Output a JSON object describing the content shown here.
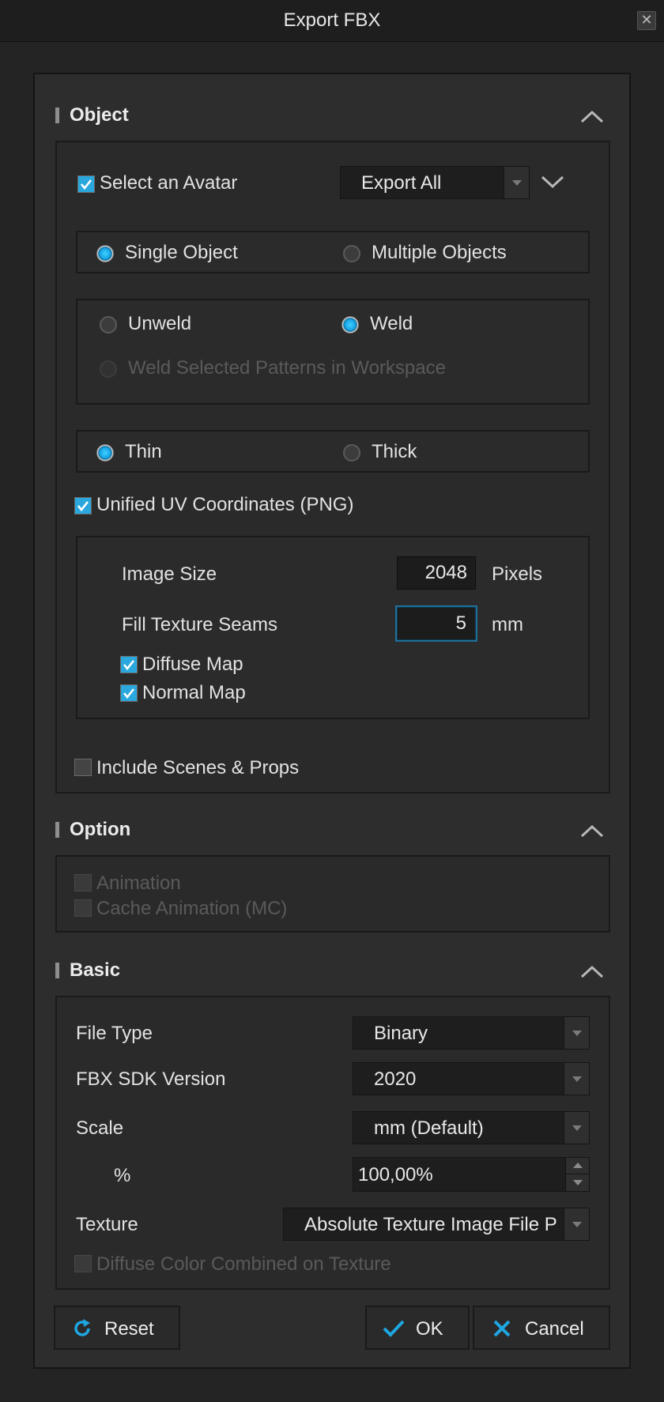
{
  "window": {
    "title": "Export FBX",
    "close_label": "✕"
  },
  "sections": {
    "object": {
      "title": "Object"
    },
    "option": {
      "title": "Option"
    },
    "basic": {
      "title": "Basic"
    }
  },
  "object": {
    "select_avatar": {
      "label": "Select an Avatar",
      "checked": true
    },
    "avatar_dropdown": {
      "value": "Export All"
    },
    "object_mode": {
      "single": "Single Object",
      "multiple": "Multiple Objects",
      "selected": "Single Object"
    },
    "weld_mode": {
      "unweld": "Unweld",
      "weld": "Weld",
      "weld_selected": "Weld Selected Patterns in Workspace",
      "selected": "Weld"
    },
    "thickness": {
      "thin": "Thin",
      "thick": "Thick",
      "selected": "Thin"
    },
    "unified_uv": {
      "label": "Unified UV Coordinates (PNG)",
      "checked": true
    },
    "image_size": {
      "label": "Image Size",
      "value": "2048",
      "unit": "Pixels"
    },
    "fill_seams": {
      "label": "Fill Texture Seams",
      "value": "5",
      "unit": "mm"
    },
    "diffuse_map": {
      "label": "Diffuse Map",
      "checked": true
    },
    "normal_map": {
      "label": "Normal Map",
      "checked": true
    },
    "include_scenes": {
      "label": "Include Scenes & Props",
      "checked": false
    }
  },
  "option": {
    "animation": {
      "label": "Animation",
      "checked": false,
      "disabled": true
    },
    "cache_animation": {
      "label": "Cache Animation (MC)",
      "checked": false,
      "disabled": true
    }
  },
  "basic": {
    "file_type": {
      "label": "File Type",
      "value": "Binary"
    },
    "sdk_version": {
      "label": "FBX SDK Version",
      "value": "2020"
    },
    "scale": {
      "label": "Scale",
      "value": "mm (Default)"
    },
    "percent": {
      "label": "%",
      "value": "100,00%"
    },
    "texture": {
      "label": "Texture",
      "value": "Absolute Texture Image File Path"
    },
    "diffuse_combined": {
      "label": "Diffuse Color Combined on Texture",
      "checked": false,
      "disabled": true
    }
  },
  "buttons": {
    "reset": "Reset",
    "ok": "OK",
    "cancel": "Cancel"
  },
  "colors": {
    "accent": "#1ea7e1",
    "background": "#242424",
    "panel": "#2a2a2a"
  },
  "icons": {
    "reset": "refresh-icon",
    "ok": "checkmark-icon",
    "cancel": "x-icon",
    "collapse": "chevron-up-icon",
    "expand": "chevron-down-icon",
    "dropdown": "triangle-down-icon"
  }
}
